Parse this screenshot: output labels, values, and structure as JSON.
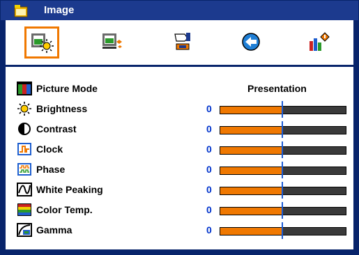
{
  "window": {
    "title": "Image",
    "title_icon": "menu-folder-icon"
  },
  "tabs": [
    {
      "name": "image-settings-tab",
      "icon": "image-sun-icon",
      "active": true
    },
    {
      "name": "display-tab",
      "icon": "screen-settings-icon",
      "active": false
    },
    {
      "name": "setup-tab",
      "icon": "hand-wrench-icon",
      "active": false
    },
    {
      "name": "options-tab",
      "icon": "globe-arrow-icon",
      "active": false
    },
    {
      "name": "info-tab",
      "icon": "bars-info-icon",
      "active": false
    }
  ],
  "settings": {
    "picture_mode": {
      "label": "Picture Mode",
      "value": "Presentation",
      "icon": "color-bars-icon"
    },
    "items": [
      {
        "key": "brightness",
        "label": "Brightness",
        "value": "0",
        "level": 0.5,
        "icon": "sun-icon"
      },
      {
        "key": "contrast",
        "label": "Contrast",
        "value": "0",
        "level": 0.5,
        "icon": "half-circle-icon"
      },
      {
        "key": "clock",
        "label": "Clock",
        "value": "0",
        "level": 0.5,
        "icon": "clock-wave-icon"
      },
      {
        "key": "phase",
        "label": "Phase",
        "value": "0",
        "level": 0.5,
        "icon": "phase-wave-icon"
      },
      {
        "key": "white_peaking",
        "label": "White Peaking",
        "value": "0",
        "level": 0.5,
        "icon": "curve-icon"
      },
      {
        "key": "color_temp",
        "label": "Color Temp.",
        "value": "0",
        "level": 0.5,
        "icon": "color-stripes-icon"
      },
      {
        "key": "gamma",
        "label": "Gamma",
        "value": "0",
        "level": 0.5,
        "icon": "gamma-curve-icon"
      }
    ]
  },
  "colors": {
    "frame": "#08246b",
    "titlebar": "#1c3a8e",
    "accent": "#f07800",
    "value_text": "#0033cc",
    "marker": "#1a5bd6"
  }
}
